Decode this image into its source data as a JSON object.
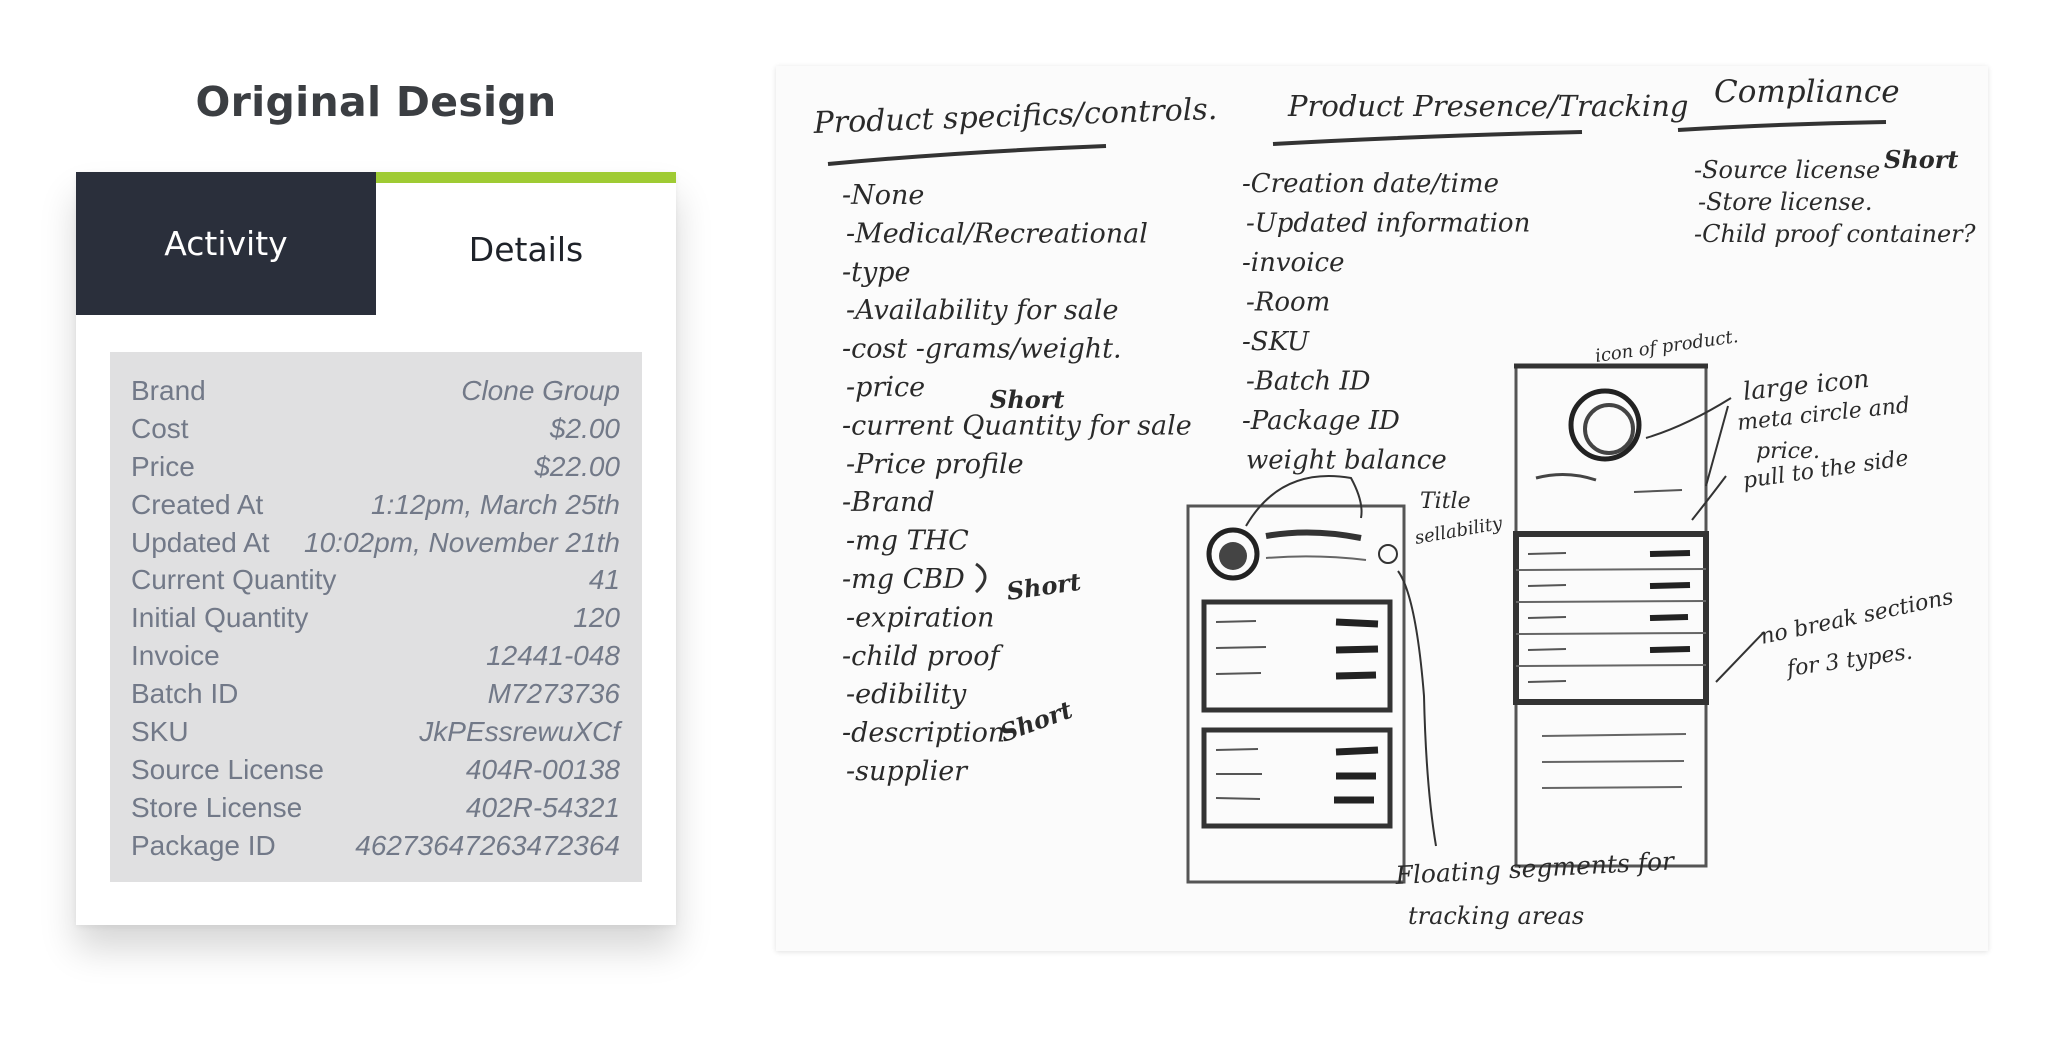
{
  "heading": "Original Design",
  "tabs": {
    "activity": "Activity",
    "details": "Details"
  },
  "details": [
    {
      "label": "Brand",
      "value": "Clone Group"
    },
    {
      "label": "Cost",
      "value": "$2.00"
    },
    {
      "label": "Price",
      "value": "$22.00"
    },
    {
      "label": "Created At",
      "value": "1:12pm, March 25th"
    },
    {
      "label": "Updated At",
      "value": "10:02pm, November 21th"
    },
    {
      "label": "Current Quantity",
      "value": "41"
    },
    {
      "label": "Initial Quantity",
      "value": "120"
    },
    {
      "label": "Invoice",
      "value": "12441-048"
    },
    {
      "label": "Batch ID",
      "value": "M7273736"
    },
    {
      "label": "SKU",
      "value": "JkPEssrewuXCf"
    },
    {
      "label": "Source License",
      "value": "404R-00138"
    },
    {
      "label": "Store License",
      "value": "402R-54321"
    },
    {
      "label": "Package ID",
      "value": "46273647263472364"
    }
  ],
  "sketch": {
    "col1_title": "Product specifics/controls.",
    "col1_items": [
      "-None",
      "-Medical/Recreational",
      "-type",
      "-Availability for sale",
      "-cost -grams/weight.",
      "-price",
      "-current Quantity for sale",
      "-Price profile",
      "-Brand",
      "-mg THC",
      "-mg CBD",
      "-expiration",
      "-child proof",
      "-edibility",
      "-description",
      "-supplier"
    ],
    "col2_title": "Product Presence/Tracking",
    "col2_items": [
      "-Creation date/time",
      "-Updated information",
      "-invoice",
      "-Room",
      "-SKU",
      "-Batch ID",
      "-Package ID",
      "weight balance"
    ],
    "col3_title": "Compliance",
    "col3_items": [
      "-Source license",
      "-Store license.",
      "-Child proof container?"
    ],
    "short_marks": [
      "Short",
      "Short",
      "Short",
      "Short"
    ],
    "notes": {
      "title": "Title",
      "sellability": "sellability",
      "icon_of_product": "icon of product.",
      "large_icon": "large icon",
      "meta_circle": "meta circle and",
      "price": "price.",
      "pull_to_side": "pull to the side",
      "no_break": "no break sections",
      "for_3_types": "for 3 types.",
      "floating_1": "Floating segments for",
      "floating_2": "tracking areas"
    }
  },
  "colors": {
    "tab_dark": "#2a2f3b",
    "tab_accent": "#9fcb33",
    "panel_bg": "#e0e0e1",
    "panel_text": "#727988"
  }
}
